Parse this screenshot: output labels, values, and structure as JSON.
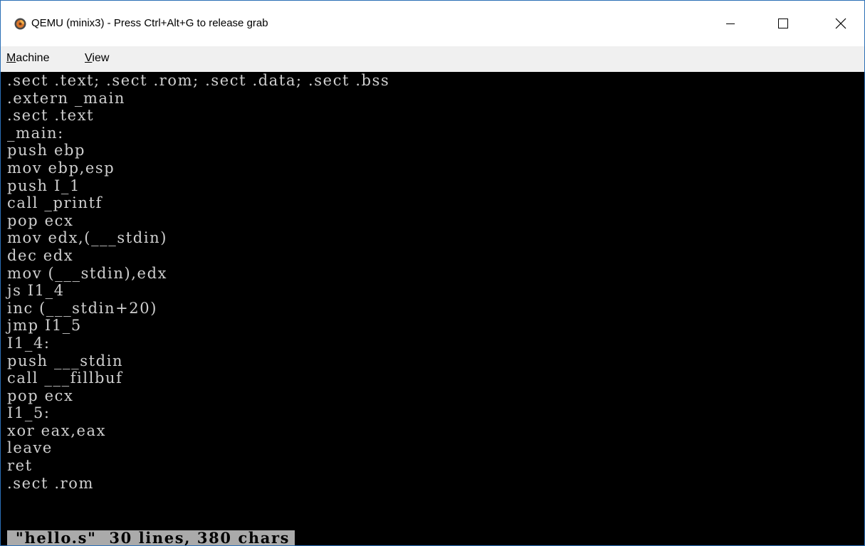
{
  "window": {
    "title": "QEMU (minix3) - Press Ctrl+Alt+G to release grab"
  },
  "menu": {
    "machine_accel": "M",
    "machine_rest": "achine",
    "view_accel": "V",
    "view_rest": "iew"
  },
  "terminal": {
    "lines": [
      ".sect .text; .sect .rom; .sect .data; .sect .bss",
      ".extern _main",
      ".sect .text",
      "_main:",
      "push ebp",
      "mov ebp,esp",
      "push I_1",
      "call _printf",
      "pop ecx",
      "mov edx,(___stdin)",
      "dec edx",
      "mov (___stdin),edx",
      "js I1_4",
      "inc (___stdin+20)",
      "jmp I1_5",
      "I1_4:",
      "push ___stdin",
      "call ___fillbuf",
      "pop ecx",
      "I1_5:",
      "xor eax,eax",
      "leave",
      "ret",
      ".sect .rom"
    ],
    "status": " \"hello.s\"  30 lines, 380 chars"
  },
  "icons": {
    "app": "qemu-logo-icon",
    "minimize": "minimize-icon",
    "maximize": "maximize-icon",
    "close": "close-icon"
  }
}
